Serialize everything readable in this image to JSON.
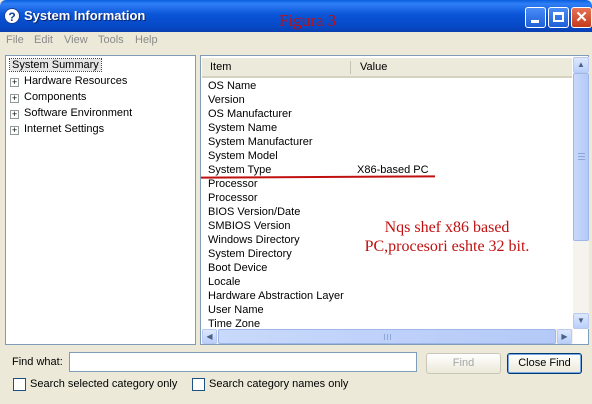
{
  "window": {
    "title": "System Information",
    "annotation_label": "Figura 3",
    "icon": "question-mark-icon",
    "controls": [
      "minimize-icon",
      "maximize-icon",
      "close-icon"
    ]
  },
  "menu": {
    "items": [
      "File",
      "Edit",
      "View",
      "Tools",
      "Help"
    ]
  },
  "tree": {
    "root": "System Summary",
    "children": [
      {
        "label": "Hardware Resources",
        "expander": "+"
      },
      {
        "label": "Components",
        "expander": "+"
      },
      {
        "label": "Software Environment",
        "expander": "+"
      },
      {
        "label": "Internet Settings",
        "expander": "+"
      }
    ]
  },
  "table": {
    "columns": [
      "Item",
      "Value"
    ],
    "rows": [
      {
        "item": "OS Name",
        "value": ""
      },
      {
        "item": "Version",
        "value": ""
      },
      {
        "item": "OS Manufacturer",
        "value": ""
      },
      {
        "item": "System Name",
        "value": ""
      },
      {
        "item": "System Manufacturer",
        "value": ""
      },
      {
        "item": "System Model",
        "value": ""
      },
      {
        "item": "System Type",
        "value": "X86-based PC"
      },
      {
        "item": "Processor",
        "value": ""
      },
      {
        "item": "Processor",
        "value": ""
      },
      {
        "item": "BIOS Version/Date",
        "value": ""
      },
      {
        "item": "SMBIOS Version",
        "value": ""
      },
      {
        "item": "Windows Directory",
        "value": ""
      },
      {
        "item": "System Directory",
        "value": ""
      },
      {
        "item": "Boot Device",
        "value": ""
      },
      {
        "item": "Locale",
        "value": ""
      },
      {
        "item": "Hardware Abstraction Layer",
        "value": ""
      },
      {
        "item": "User Name",
        "value": ""
      },
      {
        "item": "Time Zone",
        "value": ""
      }
    ]
  },
  "annotation": {
    "note": "Nqs shef x86 based PC,procesori eshte 32 bit.",
    "color": "#c01010"
  },
  "find": {
    "label": "Find what:",
    "value": "",
    "find_button": "Find",
    "close_button": "Close Find",
    "option_selected": "Search selected category only",
    "option_names": "Search category names only"
  },
  "colors": {
    "titlebar": "#0a55d8",
    "window_bg": "#ece9d8",
    "pane_border": "#7f9db9"
  }
}
